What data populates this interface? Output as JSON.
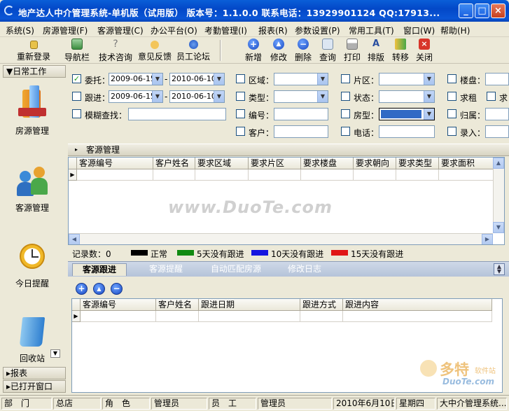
{
  "window": {
    "title": "地产达人中介管理系统-单机版（试用版） 版本号：1.1.0.0 联系电话：13929901124 QQ:17913...",
    "controls": [
      "_",
      "□",
      "×"
    ]
  },
  "menu": [
    "系统(S)",
    "房源管理(F)",
    "客源管理(C)",
    "办公平台(O)",
    "考勤管理(I)",
    "报表(R)",
    "参数设置(P)",
    "常用工具(T)",
    "窗口(W)",
    "帮助(H)"
  ],
  "toolbar": {
    "left": [
      "重新登录",
      "导航栏",
      "技术咨询",
      "意见反馈",
      "员工论坛"
    ],
    "right": [
      "新增",
      "修改",
      "删除",
      "查询",
      "打印",
      "排版",
      "转移",
      "关闭"
    ]
  },
  "sidebar": {
    "section": "日常工作",
    "items": [
      "房源管理",
      "客源管理",
      "今日提醒",
      "回收站"
    ],
    "footer": [
      "报表",
      "已打开窗口"
    ]
  },
  "filters": {
    "entrust_label": "委托：",
    "entrust_from": "2009-06-15",
    "entrust_to": "2010-06-10",
    "followup_label": "跟进：",
    "followup_from": "2009-06-15",
    "followup_to": "2010-06-10",
    "fuzzy_label": "模糊查找：",
    "dash": "-",
    "region": "区域：",
    "type": "类型：",
    "number": "编号：",
    "customer": "客户：",
    "area": "片区：",
    "status": "状态：",
    "room": "房型：",
    "phone": "电话：",
    "building": "楼盘：",
    "rent": "求租",
    "rent2": "求",
    "belong": "归属：",
    "entry": "录入："
  },
  "customer_panel": {
    "title": "客源管理",
    "columns": [
      "客源编号",
      "客户姓名",
      "要求区域",
      "要求片区",
      "要求楼盘",
      "要求朝向",
      "要求类型",
      "要求面积"
    ]
  },
  "legend": {
    "count": "记录数：0",
    "items": [
      {
        "label": "正常",
        "color": "#000000"
      },
      {
        "label": "5天没有跟进",
        "color": "#118a11"
      },
      {
        "label": "10天没有跟进",
        "color": "#1616e0"
      },
      {
        "label": "15天没有跟进",
        "color": "#e01616"
      }
    ]
  },
  "tabs": [
    "客源跟进",
    "客源提醒",
    "自动匹配房源",
    "修改日志"
  ],
  "followup_grid": {
    "columns": [
      "客源编号",
      "客户姓名",
      "跟进日期",
      "跟进方式",
      "跟进内容"
    ]
  },
  "watermark": "www.DuoTe.com",
  "corner_logo": {
    "big": "多特",
    "small": "软件站",
    "site": "DuoTe.com"
  },
  "statusbar": [
    "部　门",
    "总店",
    "角　色",
    "管理员",
    "员　工",
    "管理员",
    "2010年6月10日",
    "星期四",
    "大中介管理系统..."
  ]
}
